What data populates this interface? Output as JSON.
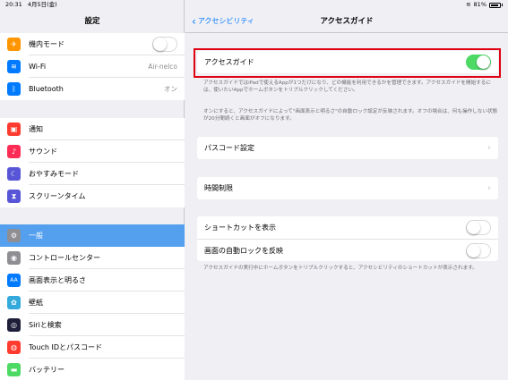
{
  "status": {
    "time": "20:31",
    "date": "4月5日(金)",
    "battery_pct": "81%"
  },
  "master": {
    "title": "設定",
    "group1": [
      {
        "icon": "airplane-icon",
        "label": "機内モード",
        "color": "#ff9500",
        "glyph": "✈",
        "switch": false
      },
      {
        "icon": "wifi-icon",
        "label": "Wi-Fi",
        "color": "#007aff",
        "glyph": "≋",
        "value": "Air-nelco"
      },
      {
        "icon": "bluetooth-icon",
        "label": "Bluetooth",
        "color": "#007aff",
        "glyph": "ᛒ",
        "value": "オン"
      }
    ],
    "group2": [
      {
        "icon": "notifications-icon",
        "label": "通知",
        "color": "#ff3b30",
        "glyph": "▣"
      },
      {
        "icon": "sounds-icon",
        "label": "サウンド",
        "color": "#ff2d55",
        "glyph": "♪"
      },
      {
        "icon": "do-not-disturb-icon",
        "label": "おやすみモード",
        "color": "#5856d6",
        "glyph": "☾"
      },
      {
        "icon": "screen-time-icon",
        "label": "スクリーンタイム",
        "color": "#5856d6",
        "glyph": "⧗"
      }
    ],
    "group3": [
      {
        "icon": "general-gear-icon",
        "label": "一般",
        "color": "#8e8e93",
        "glyph": "⚙",
        "selected": true
      },
      {
        "icon": "control-center-icon",
        "label": "コントロールセンター",
        "color": "#8e8e93",
        "glyph": "◉"
      },
      {
        "icon": "display-brightness-icon",
        "label": "画面表示と明るさ",
        "color": "#007aff",
        "glyph": "AA"
      },
      {
        "icon": "wallpaper-icon",
        "label": "壁紙",
        "color": "#34aadc",
        "glyph": "✿"
      },
      {
        "icon": "siri-icon",
        "label": "Siriと検索",
        "color": "#1f1f3a",
        "glyph": "◎"
      },
      {
        "icon": "touch-id-icon",
        "label": "Touch IDとパスコード",
        "color": "#ff3b30",
        "glyph": "◍"
      },
      {
        "icon": "battery-icon",
        "label": "バッテリー",
        "color": "#4cd964",
        "glyph": "▬"
      }
    ]
  },
  "detail": {
    "back_label": "アクセシビリティ",
    "title": "アクセスガイド",
    "guided_access_label": "アクセスガイド",
    "guided_access_on": true,
    "note1": "アクセスガイドではiPadで使えるAppが1つだけになり、どの機能を利用できるかを管理できます。アクセスガイドを開始するには、使いたいAppでホームボタンをトリプルクリックしてください。",
    "note2": "オンにすると、アクセスガイドによって\"画面表示と明るさ\"の自動ロック設定が反映されます。オフの場合は、何も操作しない状態が20分間続くと画面がオフになります。",
    "passcode_label": "パスコード設定",
    "time_limits_label": "時間制限",
    "shortcut_label": "ショートカットを表示",
    "shortcut_on": false,
    "autolock_label": "画面の自動ロックを反映",
    "autolock_on": false,
    "note3": "アクセスガイドの実行中にホームボタンをトリプルクリックすると、アクセシビリティのショートカットが表示されます。"
  },
  "accent": "#007aff",
  "highlight_color": "#e00010"
}
